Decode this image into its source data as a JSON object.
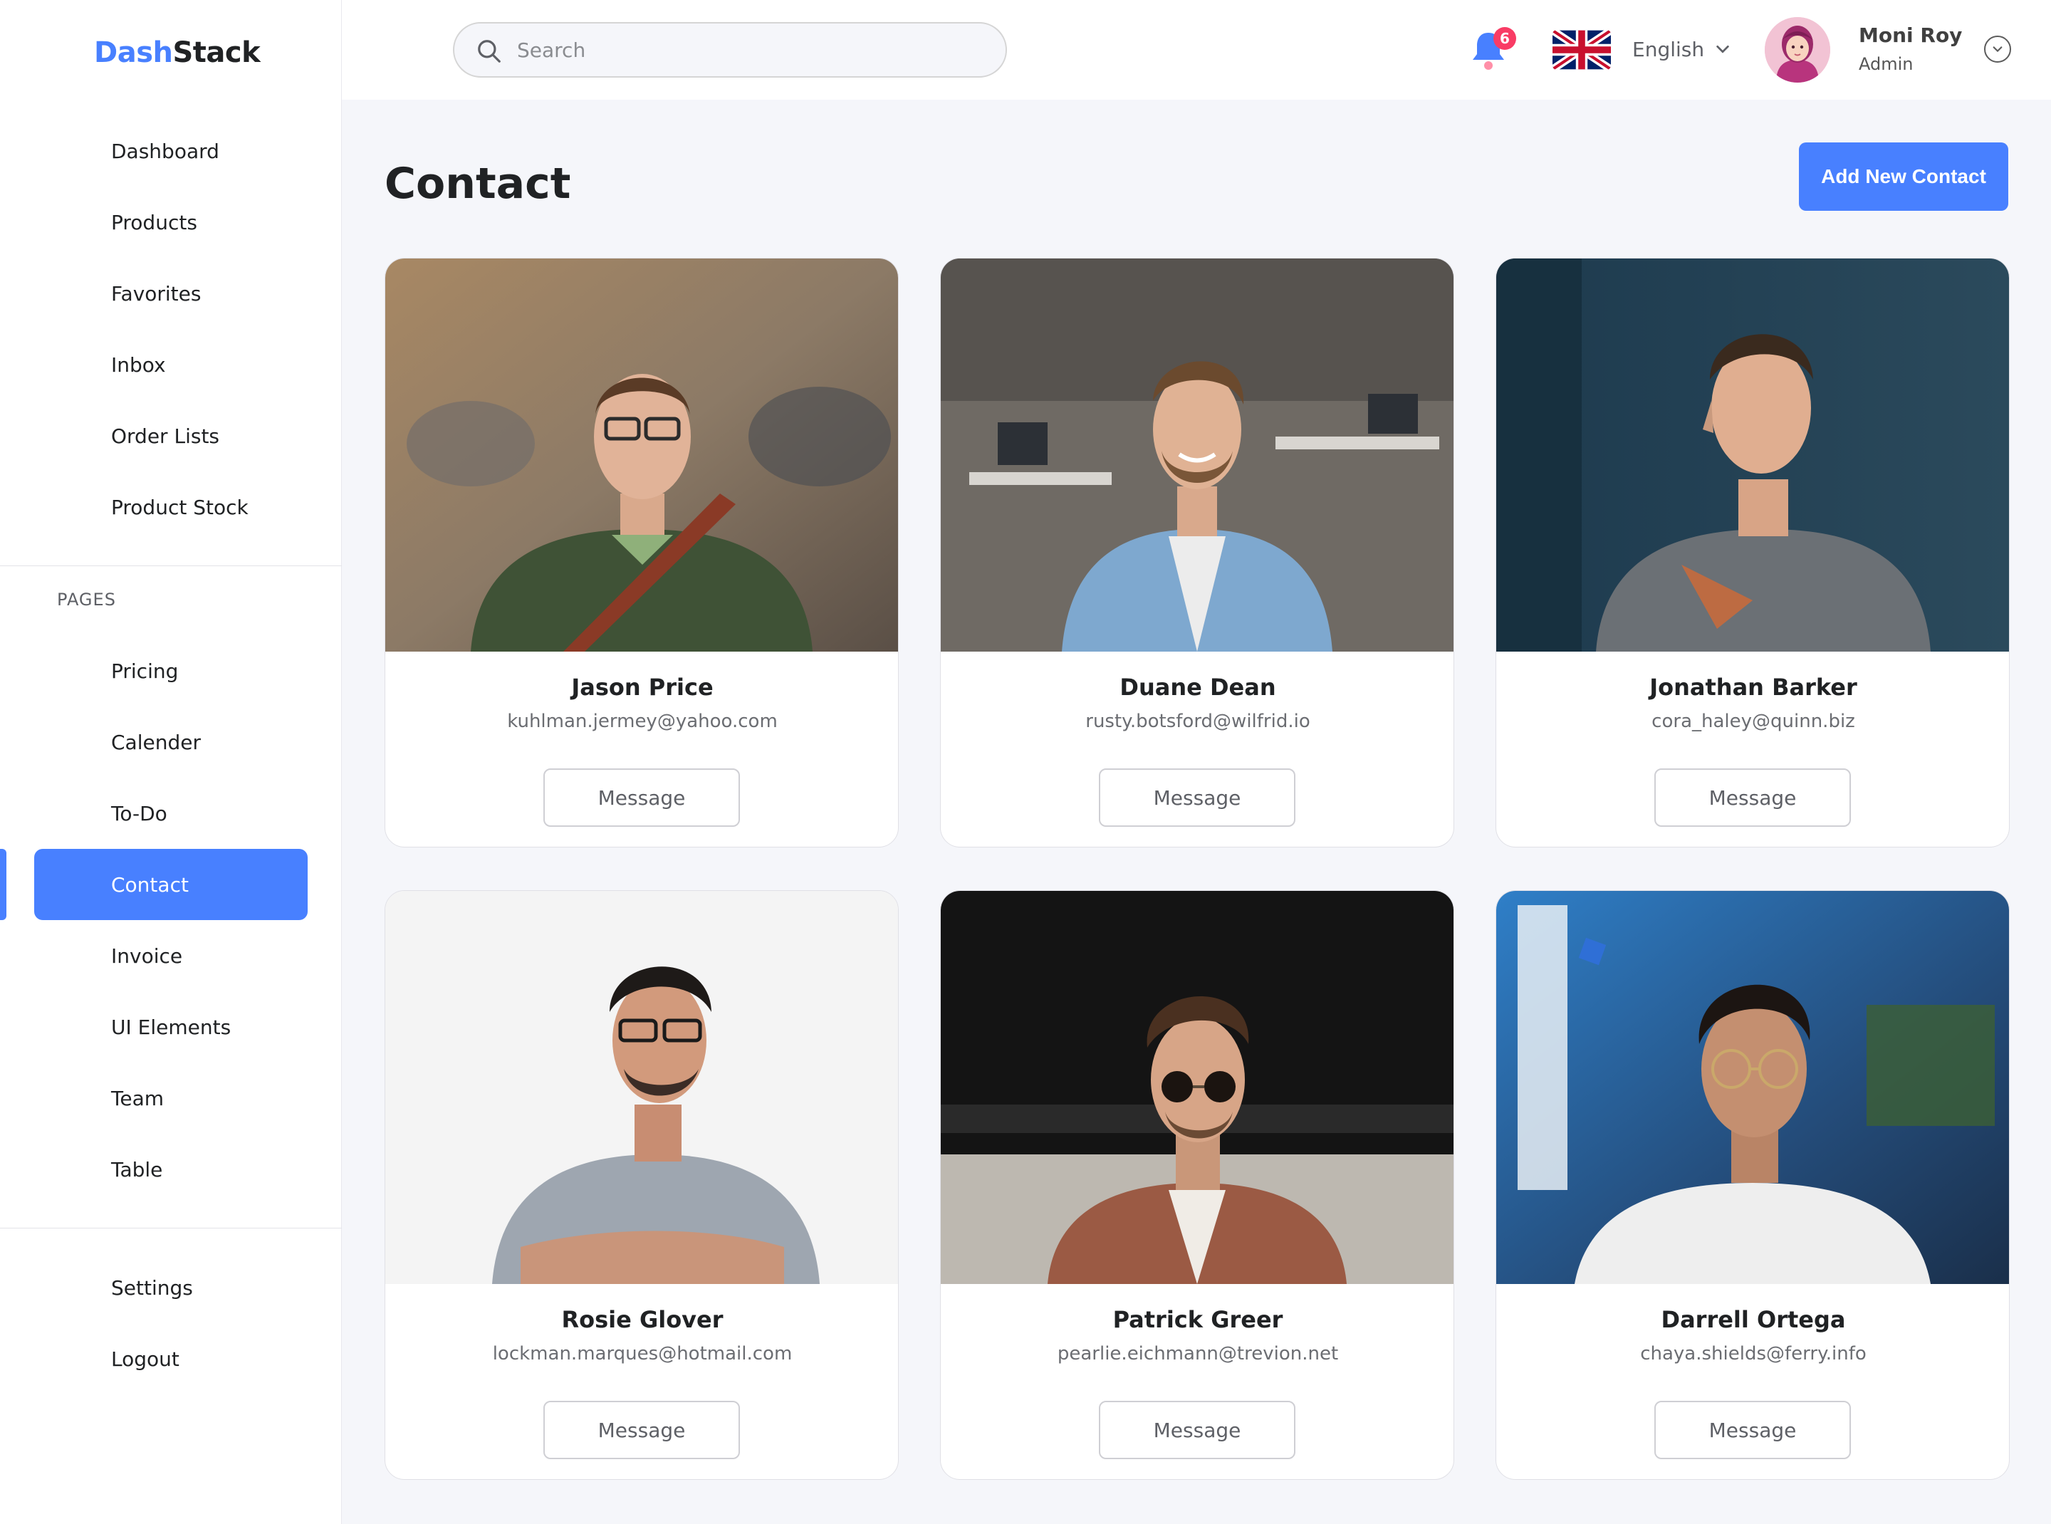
{
  "app": {
    "logo_part1": "Dash",
    "logo_part2": "Stack"
  },
  "sidebar": {
    "main_items": [
      {
        "label": "Dashboard"
      },
      {
        "label": "Products"
      },
      {
        "label": "Favorites"
      },
      {
        "label": "Inbox"
      },
      {
        "label": "Order Lists"
      },
      {
        "label": "Product Stock"
      }
    ],
    "pages_label": "PAGES",
    "page_items": [
      {
        "label": "Pricing"
      },
      {
        "label": "Calender"
      },
      {
        "label": "To-Do"
      },
      {
        "label": "Contact",
        "active": true
      },
      {
        "label": "Invoice"
      },
      {
        "label": "UI Elements"
      },
      {
        "label": "Team"
      },
      {
        "label": "Table"
      }
    ],
    "bottom_items": [
      {
        "label": "Settings"
      },
      {
        "label": "Logout"
      }
    ]
  },
  "header": {
    "search_placeholder": "Search",
    "notification_count": "6",
    "language": "English",
    "user_name": "Moni Roy",
    "user_role": "Admin"
  },
  "main": {
    "title": "Contact",
    "add_button_label": "Add New Contact",
    "contacts": [
      {
        "name": "Jason Price",
        "email": "kuhlman.jermey@yahoo.com",
        "button": "Message"
      },
      {
        "name": "Duane Dean",
        "email": "rusty.botsford@wilfrid.io",
        "button": "Message"
      },
      {
        "name": "Jonathan Barker",
        "email": "cora_haley@quinn.biz",
        "button": "Message"
      },
      {
        "name": "Rosie Glover",
        "email": "lockman.marques@hotmail.com",
        "button": "Message"
      },
      {
        "name": "Patrick Greer",
        "email": "pearlie.eichmann@trevion.net",
        "button": "Message"
      },
      {
        "name": "Darrell Ortega",
        "email": "chaya.shields@ferry.info",
        "button": "Message"
      }
    ]
  },
  "colors": {
    "accent": "#4880ff",
    "badge": "#f93c65",
    "background": "#f5f6fa"
  },
  "icons": [
    "search-icon",
    "bell-icon",
    "uk-flag-icon",
    "chevron-down-icon",
    "user-avatar"
  ]
}
